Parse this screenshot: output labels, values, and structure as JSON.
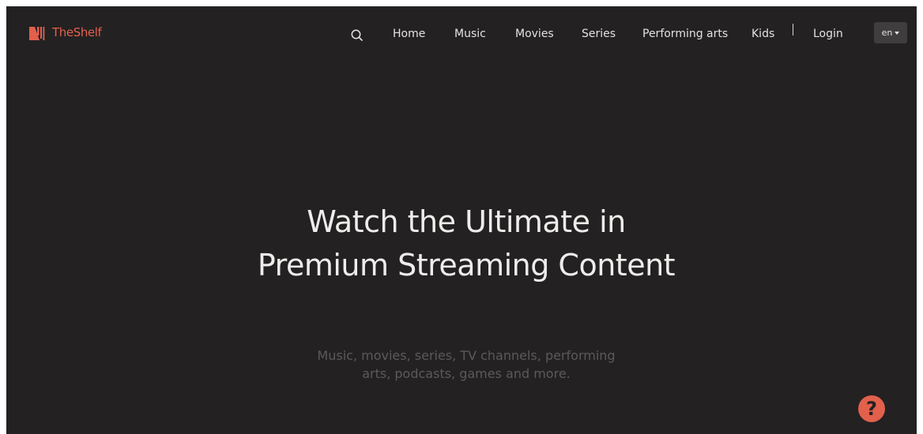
{
  "header": {
    "logo_text": "TheShelf",
    "search_icon": "search-icon",
    "nav": {
      "home": "Home",
      "music": "Music",
      "movies": "Movies",
      "series": "Series",
      "performing_arts": "Performing arts",
      "kids": "Kids"
    },
    "login": "Login",
    "language": "en"
  },
  "hero": {
    "title": "Watch the Ultimate in Premium Streaming Content",
    "subtitle": "Music, movies, series, TV channels, performing arts, podcasts, games and more."
  },
  "help": {
    "icon": "help-icon",
    "glyph": "?"
  },
  "colors": {
    "background": "#232122",
    "accent": "#e2604c",
    "nav_text": "#e4e2e0",
    "title_text": "#efedeb",
    "subtitle_text": "#5c5959",
    "language_button": "#403d3e"
  }
}
